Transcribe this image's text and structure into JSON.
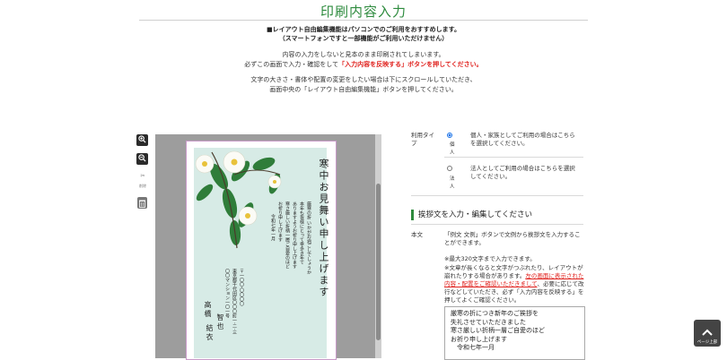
{
  "header": {
    "title": "印刷内容入力"
  },
  "notice": {
    "line1": "■レイアウト自由編集機能はパソコンでのご利用をおすすめします。",
    "line2": "（スマートフォンですと一部機能がご利用いただけません）",
    "line3": "内容の入力をしないと見本のまま印刷されてしまいます。",
    "line4_prefix": "必ずこの画面で入力・確認をして",
    "line4_red": "「入力内容を反映する」ボタンを押してください。",
    "line5": "文字の大きさ・書体や配置の変更をしたい場合は下にスクロールしていただき、",
    "line6": "画面中央の「レイアウト自由編集機能」ボタンを押してください。"
  },
  "tools": {
    "zoom_in": "zoom-in",
    "zoom_out": "zoom-out",
    "cut_label": "✂",
    "delete_label": "削除"
  },
  "card": {
    "heading": "寒中お見舞い申し上げます",
    "body": [
      "厳寒の折 いかがお過ごしでしょうか",
      "本年も皆様にとって幸多き年で",
      "ありますようお祈り申し上げます",
      "寒さ厳しい折柄一層ご自愛のほど",
      "お祈り申し上げます",
      "令和七年一月"
    ],
    "address": [
      "〒一〇〇-〇〇〇〇",
      "東京都千代田区〇〇〇町一-二-三",
      "〇〇マンション一〇一号"
    ],
    "names": [
      "高橋",
      "智也",
      "結衣"
    ]
  },
  "usage": {
    "label": "利用タイプ",
    "opt1_label": "個人",
    "opt1_desc": "個人・家族としてご利用の場合はこちらを選択してください。",
    "opt2_label": "法人",
    "opt2_desc": "法人としてご利用の場合はこちらを選択してください。"
  },
  "greeting": {
    "heading": "挨拶文を入力・編集してください",
    "label": "本文",
    "desc1": "「例文 文例」ボタンで文例から挨拶文を入力することができます。",
    "note1": "※最大320文字まで入力できます。",
    "note2": "※文章が長くなると文字がつぶれたり、レイアウトが崩れたりする場合があります。",
    "link": "左の画面に表示された内容・配置をご確認いただきまして",
    "note3": "、必要に応じて改行などしていただき、必ず「入力内容を反映する」を押してよくご確認ください。",
    "textarea_lines": [
      "厳寒の折につき新年のご挨拶を",
      "失礼させていただきました",
      "寒さ厳しい折柄一層ご自愛のほど",
      "お祈り申し上げます",
      "　令和七年一月"
    ]
  },
  "pagetop": {
    "label": "ページ上部"
  },
  "colors": {
    "accent": "#2e8b3e",
    "red": "#e0201c",
    "card_bg": "#d7ebe6"
  }
}
